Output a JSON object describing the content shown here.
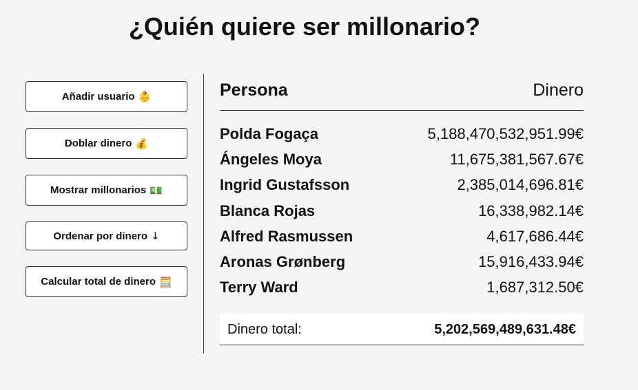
{
  "page": {
    "title": "¿Quién quiere ser millonario?"
  },
  "actions": [
    {
      "label": "Añadir usuario",
      "icon": "baby-face-emoji",
      "glyph": "👶"
    },
    {
      "label": "Doblar dinero",
      "icon": "money-bag-emoji",
      "glyph": "💰"
    },
    {
      "label": "Mostrar millonarios",
      "icon": "banknote-emoji",
      "glyph": "💵"
    },
    {
      "label": "Ordenar por dinero",
      "icon": "arrow-down",
      "glyph": "↓"
    },
    {
      "label": "Calcular total de dinero",
      "icon": "abacus-emoji",
      "glyph": "🧮"
    }
  ],
  "table": {
    "header_person": "Persona",
    "header_money": "Dinero",
    "rows": [
      {
        "name": "Polda Fogaça",
        "money": "5,188,470,532,951.99€"
      },
      {
        "name": "Ángeles Moya",
        "money": "11,675,381,567.67€"
      },
      {
        "name": "Ingrid Gustafsson",
        "money": "2,385,014,696.81€"
      },
      {
        "name": "Blanca Rojas",
        "money": "16,338,982.14€"
      },
      {
        "name": "Alfred Rasmussen",
        "money": "4,617,686.44€"
      },
      {
        "name": "Aronas Grønberg",
        "money": "15,916,433.94€"
      },
      {
        "name": "Terry Ward",
        "money": "1,687,312.50€"
      }
    ],
    "total_label": "Dinero total:",
    "total_value": "5,202,569,489,631.48€"
  }
}
